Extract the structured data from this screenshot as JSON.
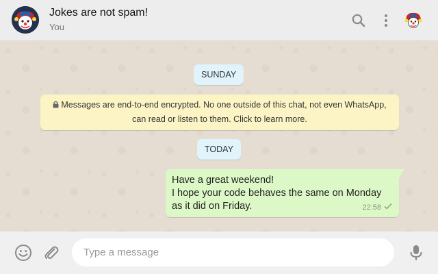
{
  "header": {
    "title": "Jokes are not spam!",
    "subtitle": "You",
    "icons": [
      "group-avatar-icon",
      "search-icon",
      "menu-icon",
      "profile-avatar-icon"
    ]
  },
  "chat": {
    "day_separators": [
      "SUNDAY",
      "TODAY"
    ],
    "encryption_notice": "Messages are end-to-end encrypted. No one outside of this chat, not even WhatsApp, can read or listen to them. Click to learn more.",
    "messages": [
      {
        "direction": "outgoing",
        "lines": [
          "Have a great weekend!",
          "I hope your code behaves the same on Monday as it did on Friday."
        ],
        "time": "22:58",
        "status": "sent-check"
      }
    ]
  },
  "composer": {
    "placeholder": "Type a message",
    "value": "",
    "icons": [
      "emoji-icon",
      "attach-icon",
      "mic-icon"
    ]
  },
  "colors": {
    "header_bg": "#ededed",
    "chat_bg": "#e6ddd2",
    "outgoing_bubble": "#dcf8c6",
    "day_chip": "#e1f3fb",
    "encryption_bg": "#fdf4c5",
    "footer_bg": "#f0f0f0"
  }
}
